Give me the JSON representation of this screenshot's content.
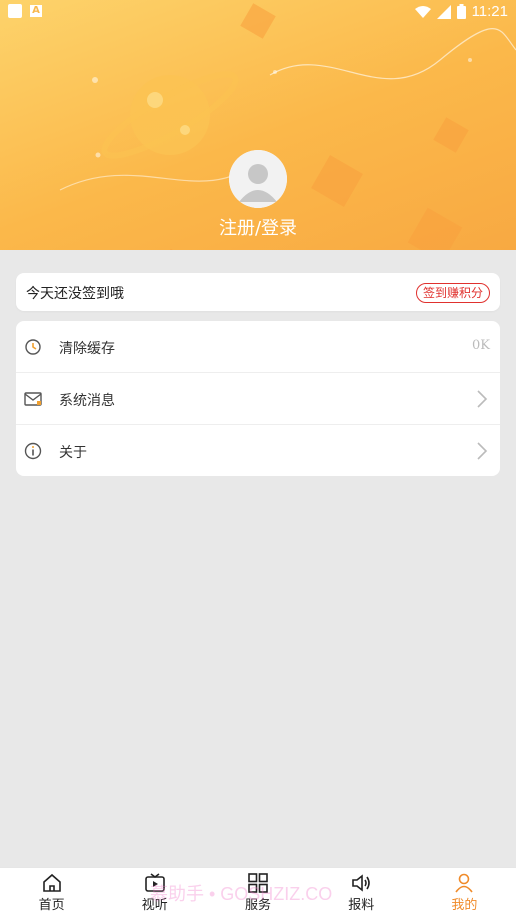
{
  "status_bar": {
    "time": "11:21"
  },
  "profile": {
    "login_label": "注册/登录"
  },
  "checkin": {
    "text": "今天还没签到哦",
    "button": "签到赚积分"
  },
  "menu": {
    "items": [
      {
        "label": "清除缓存",
        "value": "0K",
        "icon": "clock-icon"
      },
      {
        "label": "系统消息",
        "icon": "mail-icon"
      },
      {
        "label": "关于",
        "icon": "info-icon"
      }
    ]
  },
  "tabs": [
    {
      "label": "首页",
      "icon": "home-icon"
    },
    {
      "label": "视听",
      "icon": "tv-icon"
    },
    {
      "label": "服务",
      "icon": "grid-icon"
    },
    {
      "label": "报料",
      "icon": "speaker-icon"
    },
    {
      "label": "我的",
      "icon": "person-icon",
      "active": true
    }
  ],
  "watermark": "慕助手 • GOSHZIZ.CO",
  "colors": {
    "accent": "#f08b2a",
    "hero_start": "#fdd36b",
    "hero_end": "#f7a33f",
    "badge_red": "#e0312e"
  }
}
